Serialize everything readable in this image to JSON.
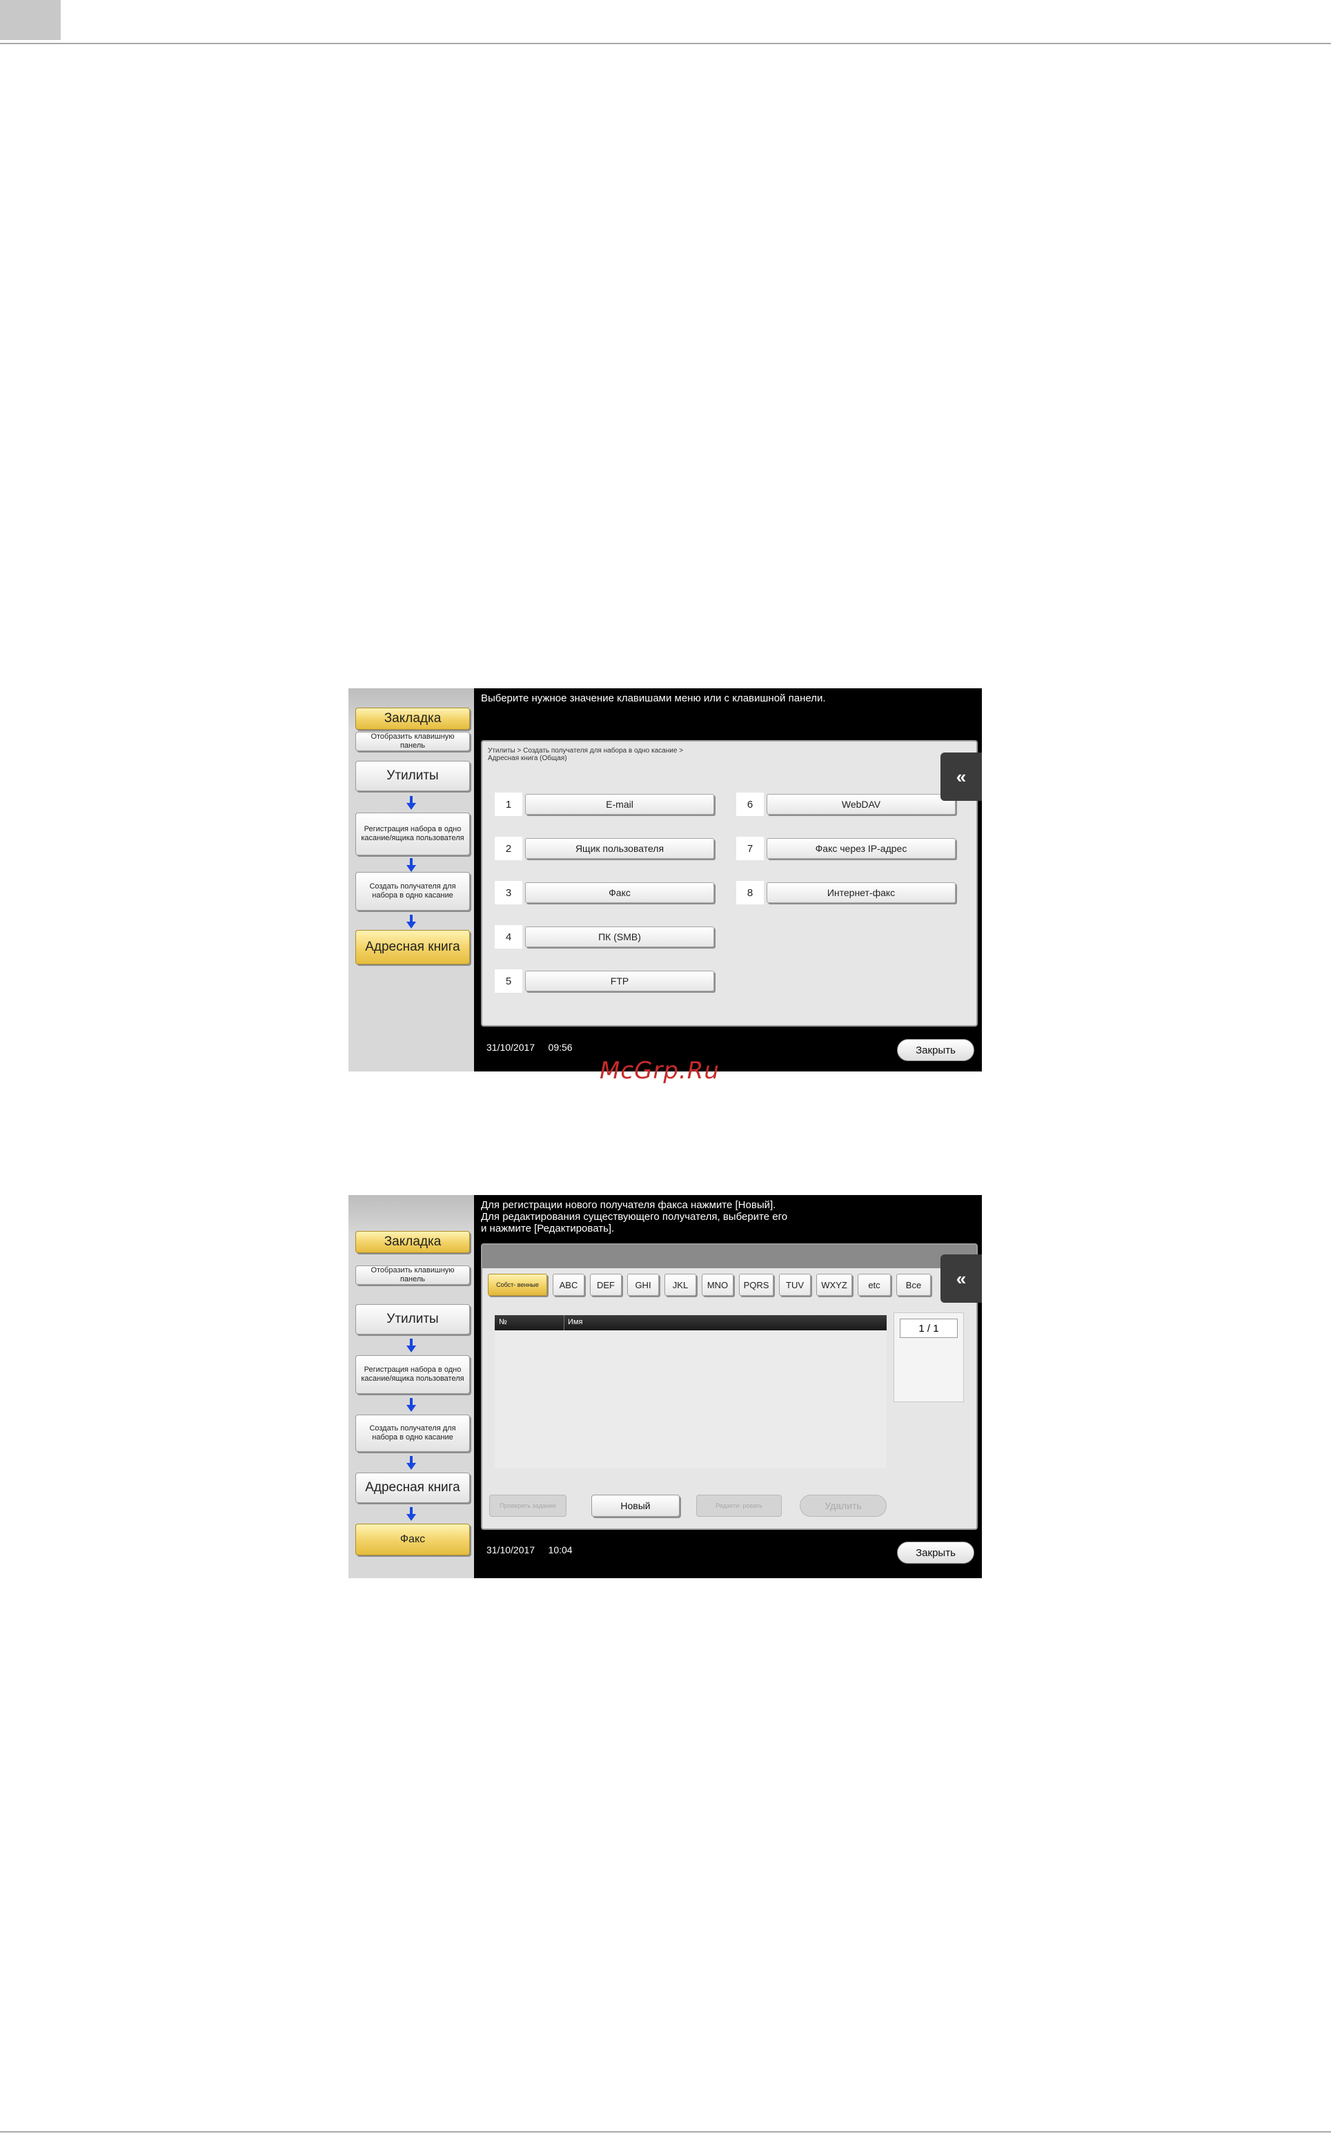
{
  "watermark": "McGrp.Ru",
  "screen1": {
    "message": "Выберите нужное значение клавишами меню или с клавишной панели.",
    "breadcrumb_line1": "Утилиты > Создать получателя для набора в одно касание >",
    "breadcrumb_line2": "Адресная книга (Общая)",
    "sidebar": {
      "bookmark": "Закладка",
      "show_keypad": "Отобразить клавишную панель",
      "utilities": "Утилиты",
      "one_touch_reg": "Регистрация набора в одно касание/ящика пользователя",
      "create_dest": "Создать получателя для набора в одно касание",
      "address_book": "Адресная книга"
    },
    "items": [
      {
        "num": "1",
        "label": "E-mail"
      },
      {
        "num": "2",
        "label": "Ящик пользователя"
      },
      {
        "num": "3",
        "label": "Факс"
      },
      {
        "num": "4",
        "label": "ПК (SMB)"
      },
      {
        "num": "5",
        "label": "FTP"
      },
      {
        "num": "6",
        "label": "WebDAV"
      },
      {
        "num": "7",
        "label": "Факс через IP-адрес"
      },
      {
        "num": "8",
        "label": "Интернет-факс"
      }
    ],
    "back_icon": "«",
    "date": "31/10/2017",
    "time": "09:56",
    "close": "Закрыть"
  },
  "screen2": {
    "message_line1": "Для регистрации нового получателя факса нажмите [Новый].",
    "message_line2": "Для редактирования существующего получателя, выберите его",
    "message_line3": "и нажмите [Редактировать].",
    "sidebar": {
      "bookmark": "Закладка",
      "show_keypad": "Отобразить клавишную панель",
      "utilities": "Утилиты",
      "one_touch_reg": "Регистрация набора в одно касание/ящика пользователя",
      "create_dest": "Создать получателя для набора в одно касание",
      "address_book": "Адресная книга",
      "fax": "Факс"
    },
    "tabs": [
      "Собст- венные",
      "ABC",
      "DEF",
      "GHI",
      "JKL",
      "MNO",
      "PQRS",
      "TUV",
      "WXYZ",
      "etc",
      "Все"
    ],
    "col_no": "№",
    "col_name": "Имя",
    "page": "1 / 1",
    "buttons": {
      "check_job": "Проверить задание",
      "new": "Новый",
      "edit": "Редакти- ровать",
      "delete": "Удалить"
    },
    "back_icon": "«",
    "date": "31/10/2017",
    "time": "10:04",
    "close": "Закрыть"
  }
}
